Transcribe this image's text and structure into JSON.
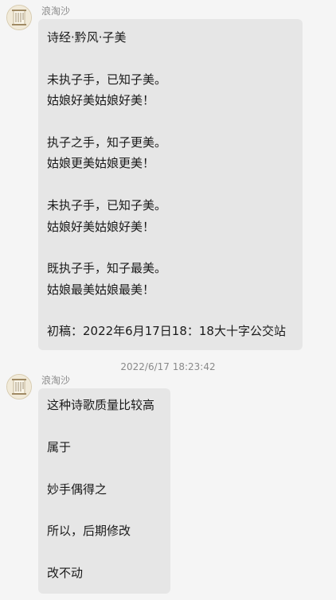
{
  "messages": [
    {
      "sender": "浪淘沙",
      "avatar_icon": "scroll-avatar-icon",
      "lines": [
        "诗经·黔风·子美",
        "",
        "未执子手，已知子美。",
        "姑娘好美姑娘好美！",
        "",
        "执子之手，知子更美。",
        "姑娘更美姑娘更美！",
        "",
        "未执子手，已知子美。",
        "姑娘好美姑娘好美！",
        "",
        "既执子手，知子最美。",
        "姑娘最美姑娘最美！",
        "",
        "初稿：2022年6月17日18：18大十字公交站"
      ]
    },
    {
      "timestamp": "2022/6/17 18:23:42",
      "sender": "浪淘沙",
      "avatar_icon": "scroll-avatar-icon",
      "lines": [
        "这种诗歌质量比较高",
        "",
        "属于",
        "",
        "妙手偶得之",
        "",
        "所以，后期修改",
        "",
        "改不动"
      ]
    }
  ],
  "colors": {
    "background": "#f5f5f5",
    "bubble": "#e6e6e6",
    "meta_text": "#8a8a8a",
    "text": "#1a1a1a"
  }
}
